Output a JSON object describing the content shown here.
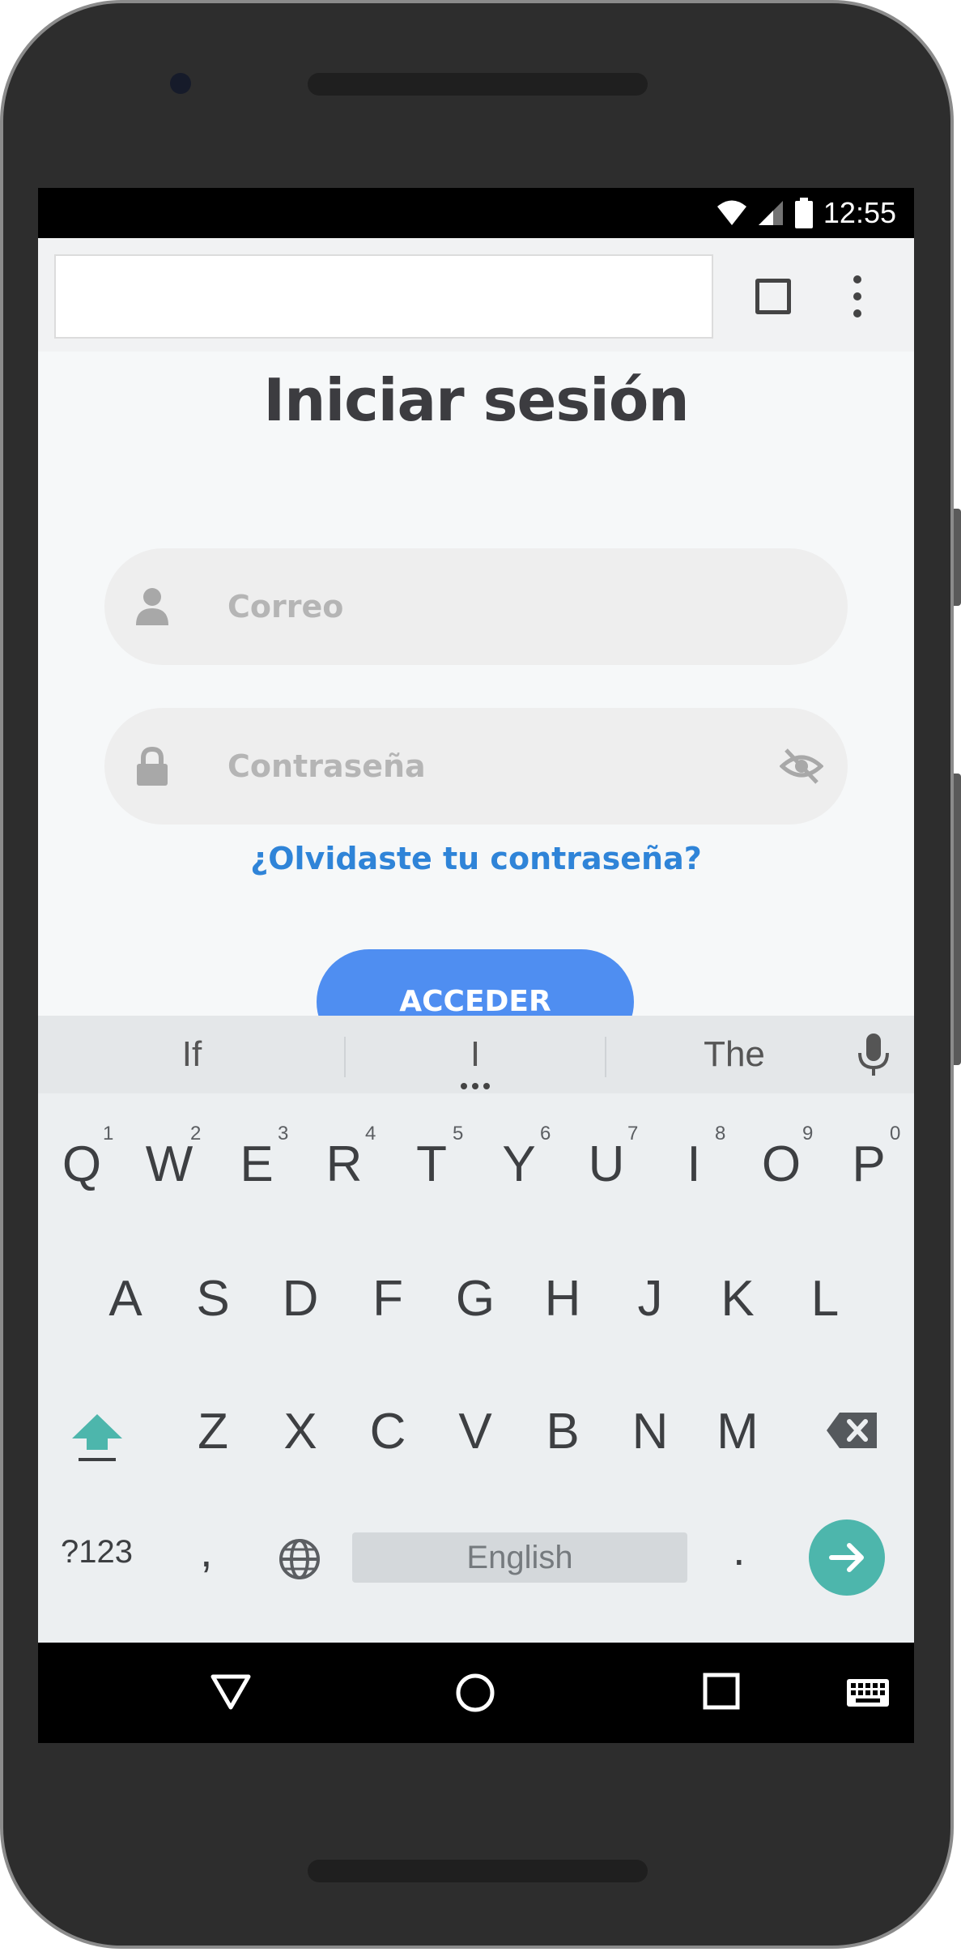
{
  "status_bar": {
    "time": "12:55"
  },
  "browser": {
    "url": ""
  },
  "page": {
    "title": "Iniciar sesión",
    "email": {
      "placeholder": "Correo",
      "value": ""
    },
    "password": {
      "placeholder": "Contraseña",
      "value": ""
    },
    "forgot_link": "¿Olvidaste tu contraseña?",
    "submit_label": "ACCEDER",
    "colors": {
      "accent": "#4f8ef1",
      "link": "#2f84d8",
      "title": "#3c3c40"
    }
  },
  "keyboard": {
    "suggestions": [
      "If",
      "I",
      "The"
    ],
    "row1": [
      {
        "key": "Q",
        "num": "1"
      },
      {
        "key": "W",
        "num": "2"
      },
      {
        "key": "E",
        "num": "3"
      },
      {
        "key": "R",
        "num": "4"
      },
      {
        "key": "T",
        "num": "5"
      },
      {
        "key": "Y",
        "num": "6"
      },
      {
        "key": "U",
        "num": "7"
      },
      {
        "key": "I",
        "num": "8"
      },
      {
        "key": "O",
        "num": "9"
      },
      {
        "key": "P",
        "num": "0"
      }
    ],
    "row2": [
      "A",
      "S",
      "D",
      "F",
      "G",
      "H",
      "J",
      "K",
      "L"
    ],
    "row3": [
      "Z",
      "X",
      "C",
      "V",
      "B",
      "N",
      "M"
    ],
    "symbols_label": "?123",
    "comma": ",",
    "space_label": "English",
    "period": ".",
    "enter_color": "#4db6ac"
  }
}
